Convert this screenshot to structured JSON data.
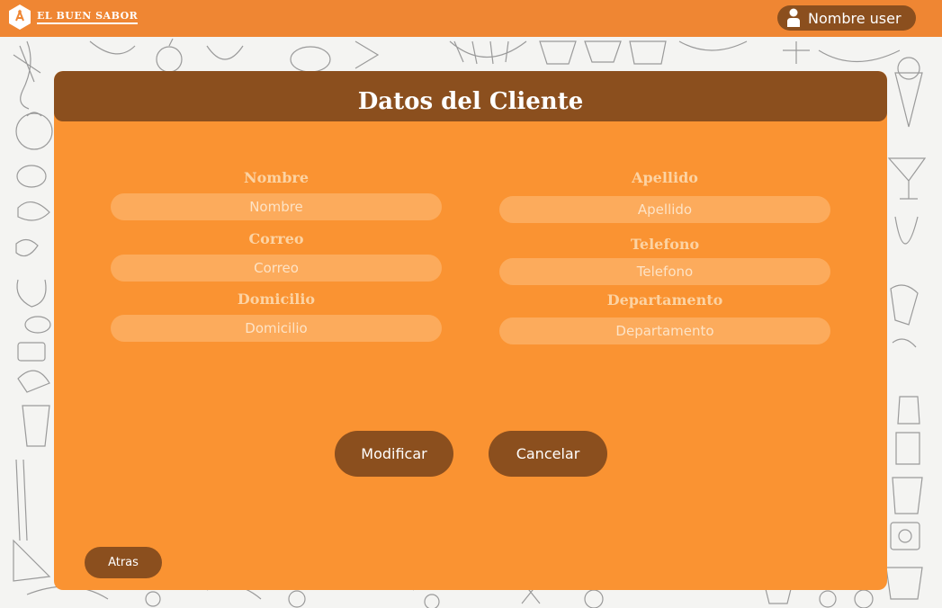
{
  "brand": {
    "name": "EL BUEN SABOR"
  },
  "header": {
    "user_label": "Nombre user"
  },
  "form": {
    "title": "Datos del Cliente",
    "fields": {
      "nombre": {
        "label": "Nombre",
        "placeholder": "Nombre"
      },
      "apellido": {
        "label": "Apellido",
        "placeholder": "Apellido"
      },
      "correo": {
        "label": "Correo",
        "placeholder": "Correo"
      },
      "telefono": {
        "label": "Telefono",
        "placeholder": "Telefono"
      },
      "domicilio": {
        "label": "Domicilio",
        "placeholder": "Domicilio"
      },
      "departamento": {
        "label": "Departamento",
        "placeholder": "Departamento"
      }
    },
    "buttons": {
      "modificar": "Modificar",
      "cancelar": "Cancelar",
      "atras": "Atras"
    }
  },
  "colors": {
    "topbar": "#ef8633",
    "card": "#fa9332",
    "dark_brown": "#8b4f1e",
    "input_bg": "#fcab5c",
    "label": "#fcd3a3"
  },
  "icons": {
    "logo": "chef-hat-icon",
    "user": "user-icon"
  }
}
